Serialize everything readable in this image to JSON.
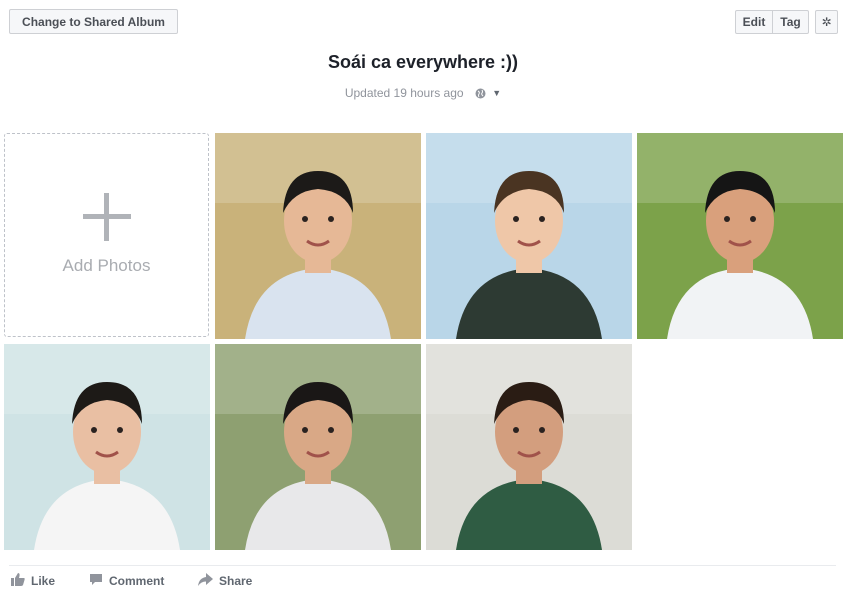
{
  "header": {
    "change_album_label": "Change to Shared Album",
    "edit_label": "Edit",
    "tag_label": "Tag",
    "settings_icon": "gear-icon"
  },
  "album": {
    "title": "Soái ca everywhere :))",
    "updated_text": "Updated 19 hours ago",
    "privacy_icon": "globe-icon"
  },
  "add_photos": {
    "label": "Add Photos",
    "icon": "plus-icon"
  },
  "photos": [
    {
      "name": "photo-1",
      "bg": "#c9b27a",
      "shirt": "#d9e3ef",
      "skin": "#e6b896",
      "hair": "#1c1a18"
    },
    {
      "name": "photo-2",
      "bg": "#b9d6e8",
      "shirt": "#2d3a33",
      "skin": "#efc7a8",
      "hair": "#4a3422"
    },
    {
      "name": "photo-3",
      "bg": "#7ca24a",
      "shirt": "#f1f3f5",
      "skin": "#d9a07c",
      "hair": "#151515"
    },
    {
      "name": "photo-4",
      "bg": "#cfe3e5",
      "shirt": "#f5f5f5",
      "skin": "#e9bfa3",
      "hair": "#1d1a17"
    },
    {
      "name": "photo-5",
      "bg": "#8ea071",
      "shirt": "#e8e8ea",
      "skin": "#d9a886",
      "hair": "#1a1716"
    },
    {
      "name": "photo-6",
      "bg": "#dcdcd6",
      "shirt": "#2f5c43",
      "skin": "#d39e7e",
      "hair": "#2a1c14"
    }
  ],
  "actions": {
    "like_label": "Like",
    "comment_label": "Comment",
    "share_label": "Share"
  },
  "colors": {
    "button_bg": "#f6f7f9",
    "text_secondary": "#90949c",
    "action_text": "#606770"
  }
}
